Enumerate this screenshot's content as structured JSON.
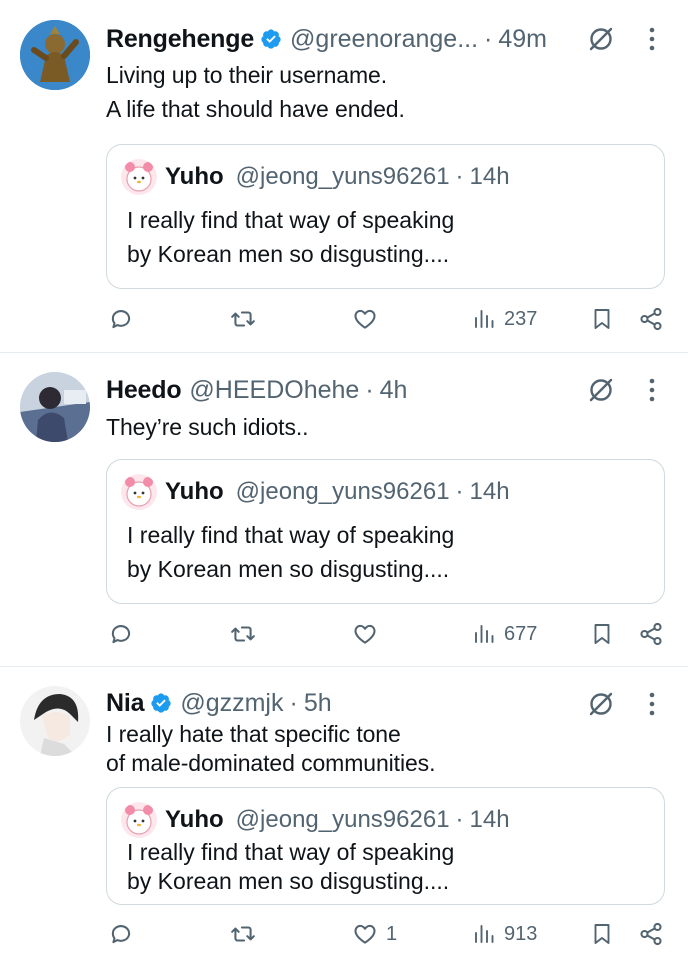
{
  "tweets": [
    {
      "author": {
        "name": "Rengehenge",
        "handle": "@greenorange...",
        "verified": true
      },
      "time": "49m",
      "text_lines": [
        "Living up to their username.",
        "A life that should have ended."
      ],
      "quote": {
        "author": {
          "name": "Yuho",
          "handle": "@jeong_yuns96261"
        },
        "time": "14h",
        "text_lines": [
          "I really find that way of speaking",
          "by Korean men so disgusting...."
        ]
      },
      "stats": {
        "replies": "",
        "retweets": "",
        "likes": "",
        "views": "237"
      }
    },
    {
      "author": {
        "name": "Heedo",
        "handle": "@HEEDOhehe",
        "verified": false
      },
      "time": "4h",
      "text_lines": [
        "They’re such idiots.."
      ],
      "quote": {
        "author": {
          "name": "Yuho",
          "handle": "@jeong_yuns96261"
        },
        "time": "14h",
        "text_lines": [
          "I really find that way of speaking",
          "by Korean men so disgusting...."
        ]
      },
      "stats": {
        "replies": "",
        "retweets": "",
        "likes": "",
        "views": "677"
      }
    },
    {
      "author": {
        "name": "Nia",
        "handle": "@gzzmjk",
        "verified": true
      },
      "time": "5h",
      "text_lines": [
        "I really hate that specific tone",
        "of male-dominated communities."
      ],
      "quote": {
        "author": {
          "name": "Yuho",
          "handle": "@jeong_yuns96261"
        },
        "time": "14h",
        "text_lines": [
          "I really find that way of speaking",
          "by Korean men so disgusting...."
        ]
      },
      "stats": {
        "replies": "",
        "retweets": "",
        "likes": "1",
        "views": "913"
      }
    }
  ],
  "separator": "·",
  "colors": {
    "accent": "#1d9bf0",
    "muted": "#536471",
    "text": "#0f1419",
    "border": "#cfd9de"
  },
  "icons": [
    "verified-badge-icon",
    "grok-icon",
    "more-icon",
    "reply-icon",
    "retweet-icon",
    "like-icon",
    "views-icon",
    "bookmark-icon",
    "share-icon"
  ]
}
